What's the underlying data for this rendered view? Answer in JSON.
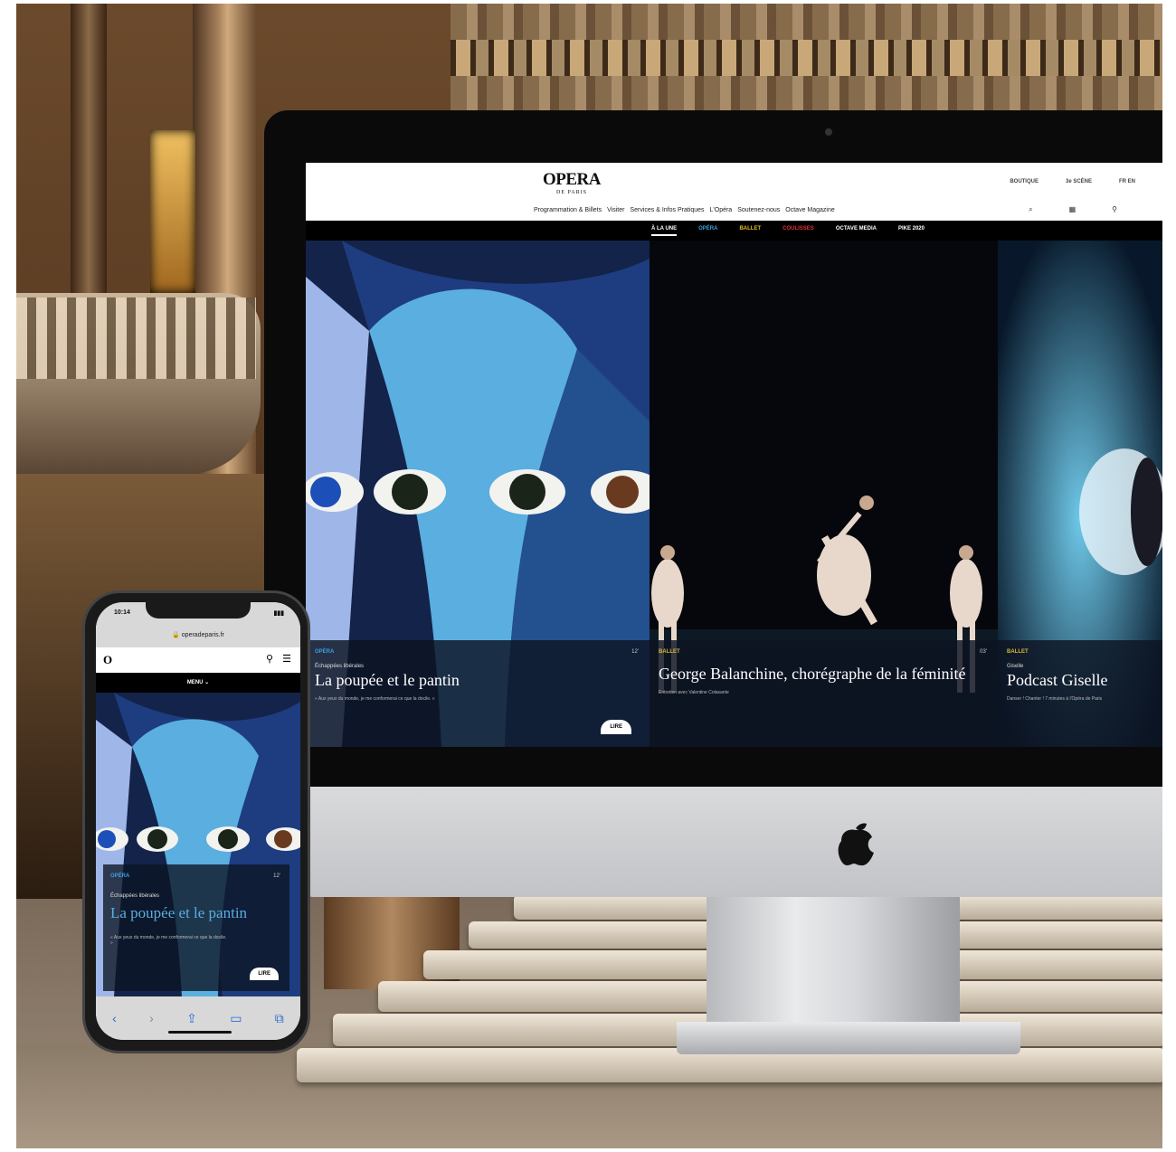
{
  "desktop": {
    "logo": "OPERA",
    "logo_sub": "DE PARIS",
    "top_links": [
      "BOUTIQUE",
      "3e SCÈNE",
      "FR EN"
    ],
    "main_nav": [
      "Programmation & Billets",
      "Visiter",
      "Services & Infos Pratiques",
      "L'Opéra",
      "Soutenez-nous",
      "Octave Magazine"
    ],
    "categories": [
      "À LA UNE",
      "OPÉRA",
      "BALLET",
      "COULISSES",
      "OCTAVE MEDIA",
      "PIKE 2020"
    ],
    "category_colors": [
      "#ffffff",
      "#3aa0e0",
      "#e0c020",
      "#e03030",
      "#ffffff",
      "#ffffff"
    ],
    "cards": [
      {
        "category": "OPÉRA",
        "subtitle": "Échappées libérales",
        "title": "La poupée et le pantin",
        "quote": "« Aux yeux du monde, je me conformerai ce que la docile. »",
        "time": "12'",
        "button": "LIRE"
      },
      {
        "category": "BALLET",
        "subtitle": "",
        "title": "George Balanchine, chorégraphe de la féminité",
        "quote": "Entretien avec Valentine Colasante",
        "time": "03'",
        "button": ""
      },
      {
        "category": "BALLET",
        "subtitle": "Giselle",
        "title": "Podcast Giselle",
        "quote": "Danser ! Chanter ! 7 minutes à l'Opéra de Paris",
        "time": "",
        "button": ""
      }
    ]
  },
  "phone": {
    "time": "10:14",
    "url": "operadeparis.fr",
    "menu": "MENU",
    "card": {
      "category": "OPÉRA",
      "subtitle": "Échappées libérales",
      "title": "La poupée et le pantin",
      "quote": "« Aux yeux du monde, je me conformerai ce que la docile. »",
      "time": "12'",
      "button": "LIRE"
    }
  },
  "colors": {
    "accent_gold": "#d9b63a",
    "navy": "#14234a",
    "sky": "#5aaee0"
  }
}
